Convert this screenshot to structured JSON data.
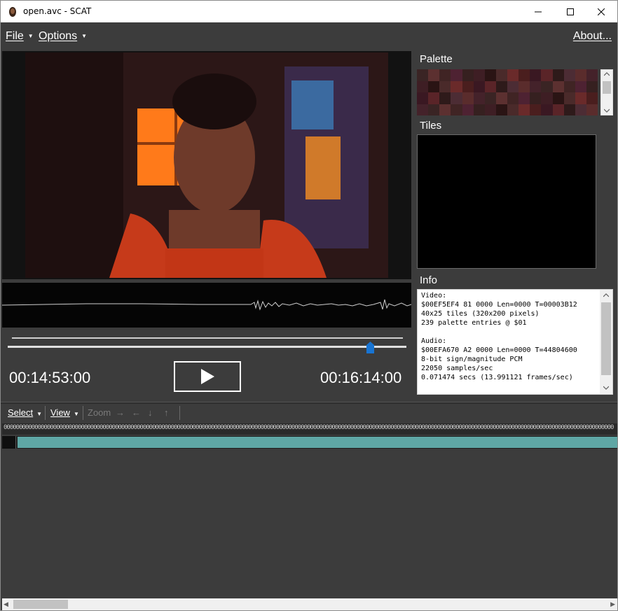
{
  "window": {
    "title": "open.avc - SCAT",
    "icons": [
      "app-icon",
      "minimize-icon",
      "maximize-icon",
      "close-icon"
    ]
  },
  "menu": {
    "file": "File",
    "options": "Options",
    "about": "About..."
  },
  "player": {
    "current_time": "00:14:53:00",
    "total_time": "00:16:14:00",
    "position_fraction": 0.91,
    "play_icon": "play-icon"
  },
  "panels": {
    "palette_label": "Palette",
    "tiles_label": "Tiles",
    "info_label": "Info"
  },
  "info": {
    "lines": [
      "Video:",
      "$00EF5EF4 81 0000 Len=0000 T=00003B12",
      "40x25 tiles (320x200 pixels)",
      "239 palette entries @ $01",
      "",
      "Audio:",
      "$00EFA670 A2 0000 Len=0000 T=44804600",
      "8-bit sign/magnitude PCM",
      "22050 samples/sec",
      "0.071474 secs (13.991121 frames/sec)"
    ]
  },
  "timeline": {
    "select": "Select",
    "view": "View",
    "zoom": "Zoom",
    "arrow_right": "→",
    "arrow_left": "←",
    "arrow_down": "↓",
    "arrow_up": "↑",
    "ruler": "00000000000000000000000000000000000000000000000000000000000000000000000000000000000000000000000000000000000000000000000000000000000000000000000000000000000000000000000000000000000000000000000000000"
  },
  "colors": {
    "background": "#3c3c3c",
    "track": "#5fa7a5",
    "slider_thumb": "#1874d2"
  }
}
